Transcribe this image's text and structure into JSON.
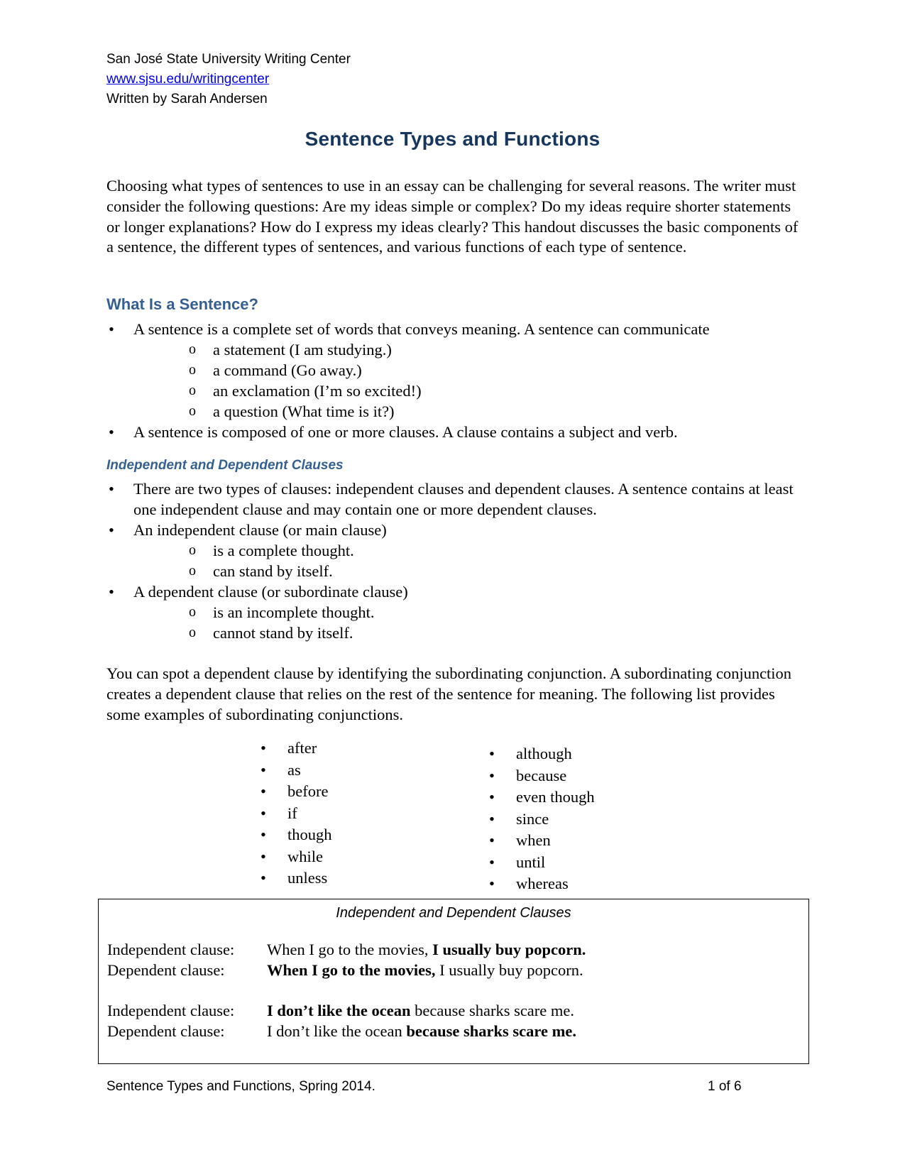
{
  "header": {
    "organization": "San José State University Writing Center",
    "website": "www.sjsu.edu/writingcenter",
    "author": "Written by Sarah Andersen"
  },
  "title": "Sentence Types and Functions",
  "intro": "Choosing what types of sentences to use in an essay can be challenging for several reasons. The writer must consider the following questions: Are my ideas simple or complex? Do my ideas require shorter statements or longer explanations? How do I express my ideas clearly? This handout discusses the basic components of a sentence, the different types of sentences, and various functions of each type of sentence.",
  "section1": {
    "heading": "What Is a Sentence?",
    "bullets": [
      {
        "text": "A sentence is a complete set of words that conveys meaning. A sentence can communicate",
        "sub": [
          "a statement (I am studying.)",
          "a command (Go away.)",
          "an exclamation (I’m so excited!)",
          "a question (What time is it?)"
        ]
      },
      {
        "text": "A sentence is composed of one or more clauses. A clause contains a subject and verb.",
        "sub": []
      }
    ]
  },
  "section2": {
    "heading": "Independent and Dependent Clauses",
    "bullets": [
      {
        "text": "There are two types of clauses: independent clauses and dependent clauses. A sentence contains at least one independent clause and may contain one or more dependent clauses.",
        "sub": []
      },
      {
        "text": "An independent clause (or main clause)",
        "sub": [
          "is a complete thought.",
          "can stand by itself."
        ]
      },
      {
        "text": "A dependent clause (or subordinate clause)",
        "sub": [
          "is an incomplete thought.",
          "cannot stand by itself."
        ]
      }
    ],
    "paragraph": "You can spot a dependent clause by identifying the subordinating conjunction. A subordinating conjunction creates a dependent clause that relies on the rest of the sentence for meaning. The following list provides some examples of subordinating conjunctions.",
    "conjunctions_left": [
      "after",
      "as",
      "before",
      "if",
      "though",
      "while",
      "unless"
    ],
    "conjunctions_right": [
      "although",
      "because",
      "even though",
      "since",
      "when",
      "until",
      "whereas"
    ]
  },
  "example_table": {
    "caption": "Independent and Dependent Clauses",
    "rows": [
      {
        "label": "Independent clause:",
        "parts": [
          {
            "text": "When I go to the movies, ",
            "bold": false
          },
          {
            "text": "I usually buy popcorn.",
            "bold": true
          }
        ]
      },
      {
        "label": "Dependent clause:",
        "parts": [
          {
            "text": "When I go to the movies,",
            "bold": true
          },
          {
            "text": " I usually buy popcorn.",
            "bold": false
          }
        ]
      },
      {
        "label": "Independent clause:",
        "parts": [
          {
            "text": "I don’t like the ocean",
            "bold": true
          },
          {
            "text": " because sharks scare me.",
            "bold": false
          }
        ]
      },
      {
        "label": "Dependent clause:",
        "parts": [
          {
            "text": "I don’t like the ocean ",
            "bold": false
          },
          {
            "text": "because sharks scare me.",
            "bold": true
          }
        ]
      }
    ]
  },
  "footer": {
    "left": "Sentence Types and Functions, Spring 2014.",
    "page": "1 of 6"
  },
  "colors": {
    "title": "#17365D",
    "heading": "#365F91",
    "link": "#0000EE"
  }
}
